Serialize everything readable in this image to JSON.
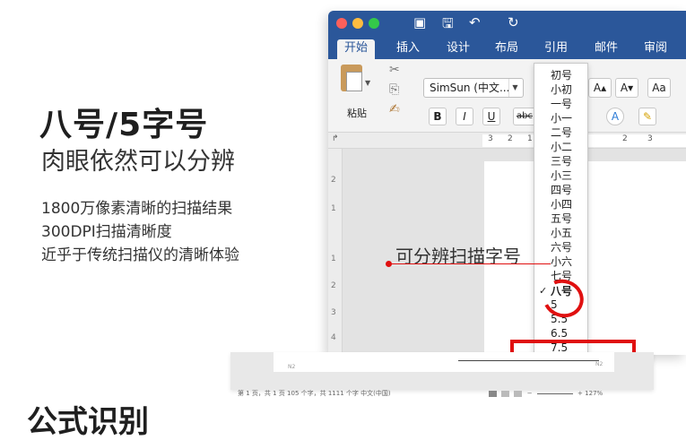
{
  "hero": {
    "title": "八号/5字号",
    "subtitle": "肉眼依然可以分辨",
    "features": [
      "1800万像素清晰的扫描结果",
      "300DPI扫描清晰度",
      "近乎于传统扫描仪的清晰体验"
    ]
  },
  "section": {
    "title": "公式识别"
  },
  "word": {
    "quick_access": {
      "sidebar_icon": "▣",
      "save_icon": "🖫",
      "undo_icon": "↶",
      "redo_icon": "↻"
    },
    "tabs": [
      {
        "label": "开始",
        "active": true
      },
      {
        "label": "插入"
      },
      {
        "label": "设计"
      },
      {
        "label": "布局"
      },
      {
        "label": "引用"
      },
      {
        "label": "邮件"
      },
      {
        "label": "审阅"
      }
    ],
    "ribbon": {
      "paste_label": "粘贴",
      "font_name": "SimSun (中文...",
      "bold": "B",
      "italic": "I",
      "underline": "U",
      "strikethrough": "abc",
      "grow": "A▴",
      "shrink": "A▾",
      "change_case": "Aa",
      "text_effects": "A",
      "highlight": "✎"
    },
    "ruler_numbers": [
      "3",
      "2",
      "1",
      "2",
      "3"
    ],
    "vruler_numbers": [
      "2",
      "1",
      "1",
      "2",
      "3",
      "4"
    ]
  },
  "font_size_menu": {
    "items": [
      "初号",
      "小初",
      "一号",
      "小一",
      "二号",
      "小二",
      "三号",
      "小三",
      "四号",
      "小四",
      "五号",
      "小五",
      "六号",
      "小六",
      "七号",
      "八号",
      "5",
      "5.5",
      "6.5",
      "7.5"
    ],
    "selected": "八号",
    "check_mark": "✓"
  },
  "callout": {
    "label": "可分辨扫描字号"
  },
  "status_bar": {
    "left": "第 1 页，共 1 页    105 个字，共 1111 个字    中文(中国)",
    "zoom": "127%"
  },
  "doc_strip": {
    "mark_left": "N2",
    "mark_right": "N2"
  },
  "colors": {
    "titlebar": "#2b579a",
    "ribbon": "#f3f3f3",
    "accent_red": "#e01010"
  }
}
